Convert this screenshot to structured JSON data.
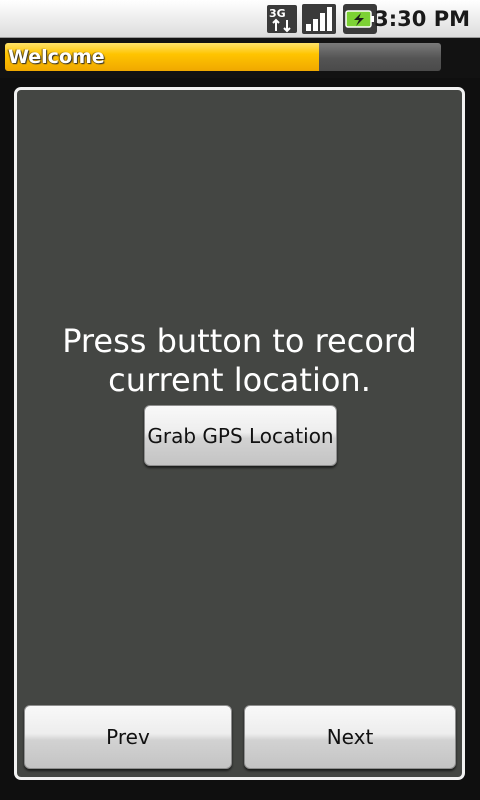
{
  "status_bar": {
    "network_label": "3G",
    "network_icon": "3g-data-icon",
    "signal_icon": "signal-strength-icon",
    "battery_icon": "battery-charging-icon",
    "time": "3:30 PM"
  },
  "progress": {
    "label": "Welcome",
    "fraction": 0.72,
    "fill_color": "#ffc400"
  },
  "main": {
    "prompt": "Press button to record current location.",
    "grab_button_label": "Grab GPS Location"
  },
  "nav": {
    "prev_label": "Prev",
    "next_label": "Next"
  }
}
